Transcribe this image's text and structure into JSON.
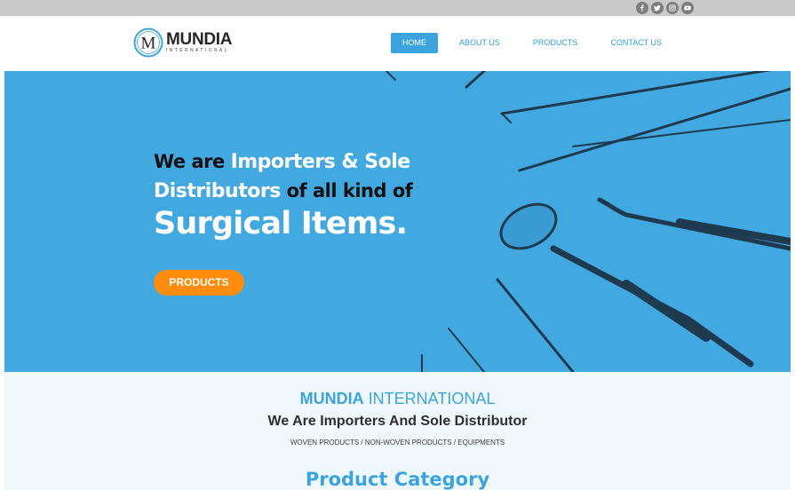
{
  "colors": {
    "accent": "#3ba4de",
    "hero_bg": "#42a8e0",
    "cta": "#ff8c0d",
    "topbar": "#c9c9c9"
  },
  "social": [
    "facebook-icon",
    "twitter-icon",
    "instagram-icon",
    "youtube-icon"
  ],
  "logo": {
    "mark": "M",
    "name": "MUNDIA",
    "sub": "INTERNATIONAL"
  },
  "nav": {
    "home": "HOME",
    "about": "ABOUT US",
    "products": "PRODUCTS",
    "contact": "CONTACT US",
    "active": "HOME"
  },
  "hero": {
    "line1_dark": "We are ",
    "line1_white": "Importers & Sole",
    "line2_white": "Distributors",
    "line2_dark": " of all kind of",
    "line3": "Surgical Items.",
    "button": "PRODUCTS"
  },
  "intro": {
    "title_bold": "MUNDIA",
    "title_rest": " INTERNATIONAL",
    "subtitle": "We Are Importers And Sole Distributor",
    "small": "WOVEN PRODUCTS / NON-WOVEN PRODUCTS / EQUIPMENTS",
    "category": "Product Category"
  }
}
